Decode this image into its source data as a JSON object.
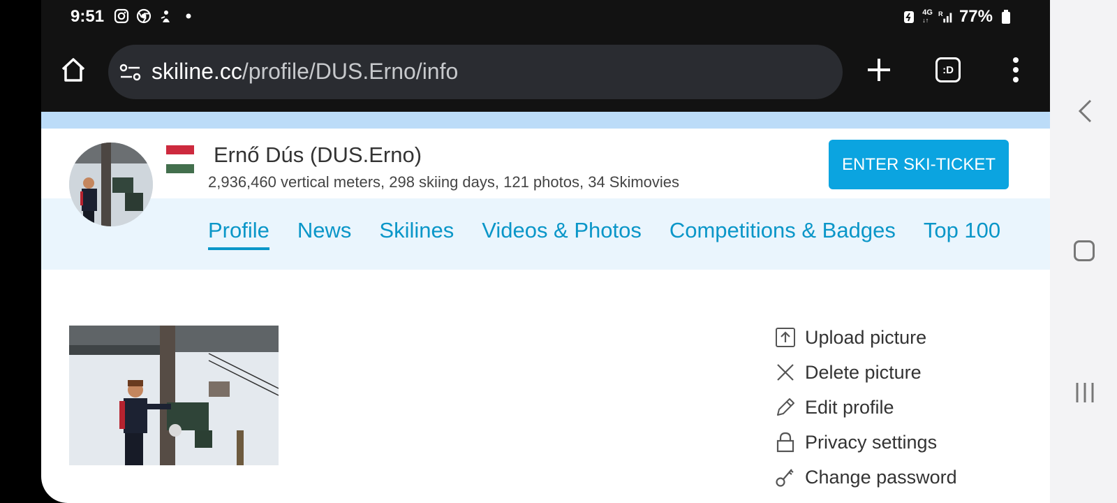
{
  "status_bar": {
    "time": "9:51",
    "network": "4G",
    "signal_label": "R",
    "battery": "77%",
    "left_icons": [
      "instagram-icon",
      "chrome-icon",
      "threads-icon",
      "dot-icon"
    ]
  },
  "browser": {
    "url_domain": "skiline.cc",
    "url_path": "/profile/DUS.Erno/info",
    "tab_switcher_label": ":D"
  },
  "profile": {
    "name": "Ernő Dús (DUS.Erno)",
    "stats": "2,936,460 vertical meters,  298 skiing days, 121 photos, 34 Skimovies",
    "flag_colors": [
      "#cd2a3e",
      "#ffffff",
      "#436f4d"
    ],
    "enter_ticket_label": "ENTER SKI-TICKET"
  },
  "tabs": [
    {
      "label": "Profile",
      "active": true
    },
    {
      "label": "News",
      "active": false
    },
    {
      "label": "Skilines",
      "active": false
    },
    {
      "label": "Videos & Photos",
      "active": false
    },
    {
      "label": "Competitions & Badges",
      "active": false
    },
    {
      "label": "Top 100",
      "active": false
    }
  ],
  "actions": [
    {
      "label": "Upload picture",
      "icon": "upload-icon"
    },
    {
      "label": "Delete picture",
      "icon": "close-icon"
    },
    {
      "label": "Edit profile",
      "icon": "pencil-icon"
    },
    {
      "label": "Privacy settings",
      "icon": "lock-icon"
    },
    {
      "label": "Change password",
      "icon": "key-icon"
    }
  ],
  "colors": {
    "accent": "#0ba4e0",
    "tab_text": "#0a96c8",
    "tab_bar_bg": "#eaf5fd",
    "top_strip": "#bcdcf8"
  }
}
